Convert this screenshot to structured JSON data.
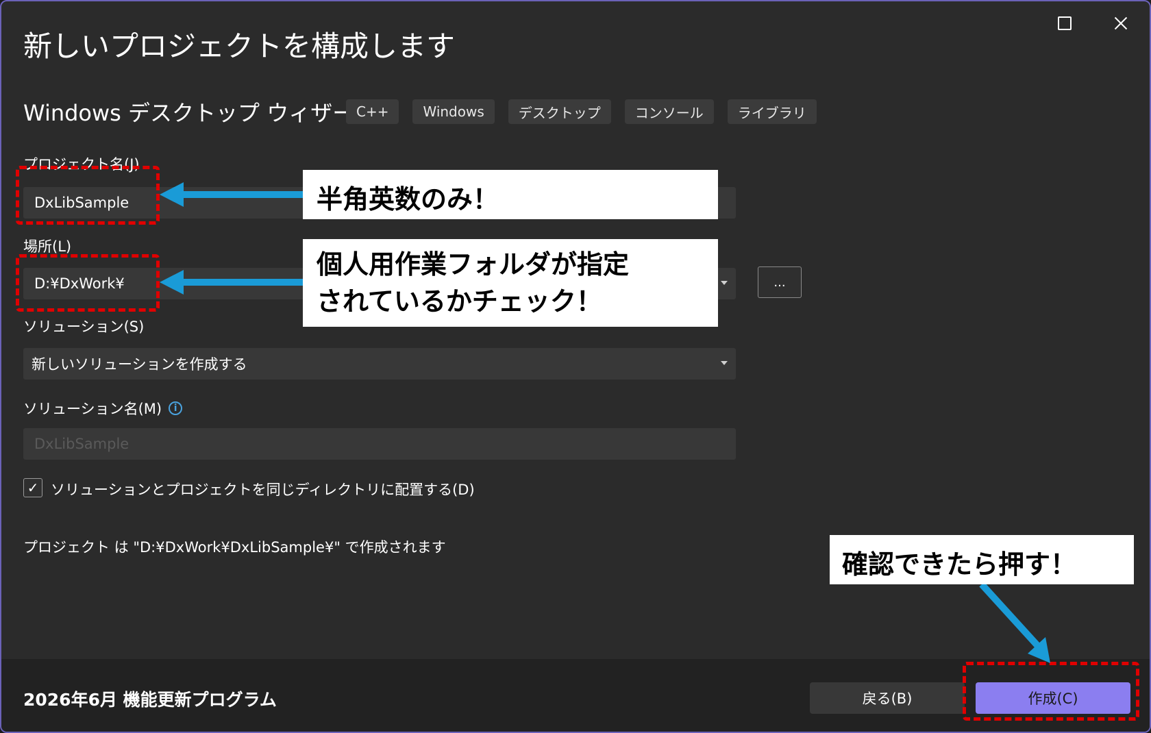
{
  "window": {
    "title": "新しいプロジェクトを構成します",
    "maximize_icon": "maximize-icon",
    "close_icon": "close-icon"
  },
  "template": {
    "name": "Windows デスクトップ ウィザード",
    "tags": [
      "C++",
      "Windows",
      "デスクトップ",
      "コンソール",
      "ライブラリ"
    ]
  },
  "fields": {
    "project_name_label": "プロジェクト名(J)",
    "project_name_value": "DxLibSample",
    "location_label": "場所(L)",
    "location_value": "D:¥DxWork¥",
    "browse_label": "...",
    "solution_label": "ソリューション(S)",
    "solution_value": "新しいソリューションを作成する",
    "solution_name_label": "ソリューション名(M)",
    "solution_name_placeholder": "DxLibSample",
    "info_icon": "i",
    "same_dir_checkbox_checked": true,
    "same_dir_label": "ソリューションとプロジェクトを同じディレクトリに配置する(D)",
    "checkmark": "✓"
  },
  "path_info": "プロジェクト は \"D:¥DxWork¥DxLibSample¥\" で作成されます",
  "footer": {
    "text": "2026年6月 機能更新プログラム",
    "back_label": "戻る(B)",
    "create_label": "作成(C)"
  },
  "annotations": {
    "name_note": "半角英数のみ！",
    "location_note": "個人用作業フォルダが指定\nされているかチェック！",
    "create_note": "確認できたら押す！"
  },
  "colors": {
    "accent": "#8b7ef0",
    "highlight": "#e00000",
    "arrow": "#1a9bd7",
    "background": "#2b2b2b"
  }
}
